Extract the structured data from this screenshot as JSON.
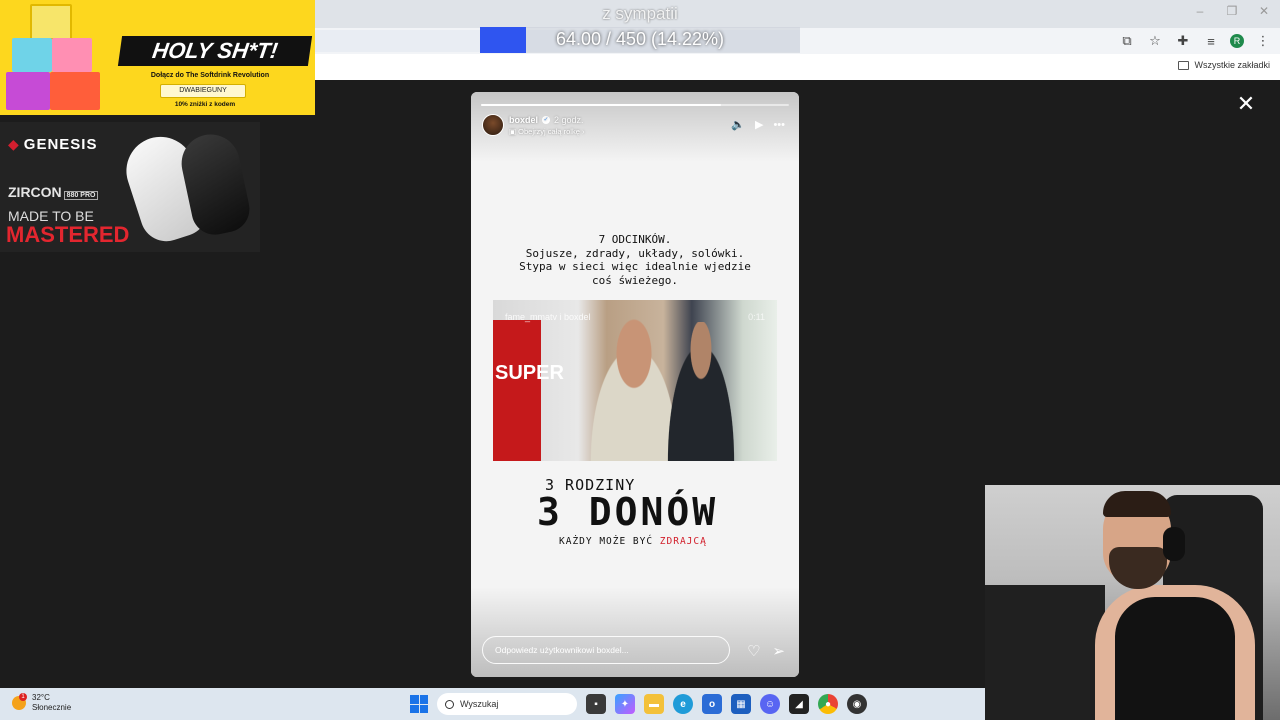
{
  "overlay": {
    "title": "z sympatii",
    "goal": {
      "text": "64.00 / 450 (14.22%)",
      "fraction": 0.1422
    }
  },
  "ads": {
    "softdrink": {
      "headline": "HOLY SH*T!",
      "subline": "Dołącz do The Softdrink Revolution",
      "code": "DWABIEGUNY",
      "discount": "10% zniżki z kodem"
    },
    "genesis": {
      "brand": "GENESIS",
      "model": "ZIRCON",
      "model_badge": "880 PRO",
      "tagline": "MADE TO BE",
      "tagline_accent": "MASTERED"
    }
  },
  "browser": {
    "bookmarks_all_label": "Wszystkie zakładki",
    "profile_initial": "R",
    "window_controls": [
      "–",
      "❐",
      "✕"
    ]
  },
  "story": {
    "username": "boxdel",
    "time": "2 godz.",
    "reel_link": "Obejrzyj całą rolkę",
    "progress": 0.78,
    "text_lines": [
      "7 ODCINKÓW.",
      "Sojusze, zdrady, układy, solówki.",
      "Stypa w sieci więc idealnie wjedzie",
      "coś świeżego."
    ],
    "clip_label": "fame_mmatv i boxdel",
    "clip_duration": "0:11",
    "clip_sign": "SUPER",
    "heading1": "3 RODZINY",
    "heading2": "3 DONÓW",
    "heading3_prefix": "KAŻDY MOŻE BYĆ ",
    "heading3_accent": "ZDRAJCĄ",
    "reply_placeholder": "Odpowiedz użytkownikowi boxdel..."
  },
  "taskbar": {
    "temperature": "32°C",
    "condition": "Słonecznie",
    "weather_badge": "1",
    "search_placeholder": "Wyszukaj"
  },
  "colors": {
    "accent_red": "#d21f2b",
    "goal_blue": "#2f55f0",
    "ad_yellow": "#fdd71e"
  }
}
